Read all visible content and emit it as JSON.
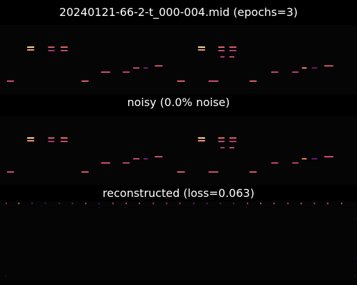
{
  "figure": {
    "title": "20240121-66-2-t_000-004.mid (epochs=3)"
  },
  "chart_data": [
    {
      "type": "heatmap",
      "panel": "original",
      "title": "",
      "background": "#050505",
      "xlim": [
        0,
        512
      ],
      "ylim": [
        0,
        100
      ],
      "colormap": "magma",
      "notes": [
        {
          "t": 10,
          "dur": 10,
          "p": 81,
          "v": 0.58
        },
        {
          "t": 39,
          "dur": 10,
          "p": 32,
          "v": 0.92
        },
        {
          "t": 39,
          "dur": 10,
          "p": 36,
          "v": 0.78
        },
        {
          "t": 69,
          "dur": 9,
          "p": 32,
          "v": 0.62
        },
        {
          "t": 69,
          "dur": 9,
          "p": 37,
          "v": 0.48
        },
        {
          "t": 87,
          "dur": 10,
          "p": 32,
          "v": 0.66
        },
        {
          "t": 87,
          "dur": 10,
          "p": 37,
          "v": 0.55
        },
        {
          "t": 117,
          "dur": 10,
          "p": 81,
          "v": 0.62
        },
        {
          "t": 145,
          "dur": 13,
          "p": 68,
          "v": 0.58
        },
        {
          "t": 176,
          "dur": 10,
          "p": 68,
          "v": 0.52
        },
        {
          "t": 191,
          "dur": 9,
          "p": 62,
          "v": 0.55
        },
        {
          "t": 206,
          "dur": 6,
          "p": 62,
          "v": 0.35
        },
        {
          "t": 222,
          "dur": 11,
          "p": 59,
          "v": 0.58
        },
        {
          "t": 254,
          "dur": 11,
          "p": 81,
          "v": 0.62
        },
        {
          "t": 284,
          "dur": 10,
          "p": 32,
          "v": 0.92
        },
        {
          "t": 284,
          "dur": 10,
          "p": 36,
          "v": 0.78
        },
        {
          "t": 299,
          "dur": 14,
          "p": 81,
          "v": 0.58
        },
        {
          "t": 313,
          "dur": 9,
          "p": 32,
          "v": 0.66
        },
        {
          "t": 313,
          "dur": 9,
          "p": 37,
          "v": 0.55
        },
        {
          "t": 316,
          "dur": 6,
          "p": 46,
          "v": 0.5
        },
        {
          "t": 329,
          "dur": 10,
          "p": 32,
          "v": 0.62
        },
        {
          "t": 329,
          "dur": 10,
          "p": 37,
          "v": 0.5
        },
        {
          "t": 329,
          "dur": 7,
          "p": 46,
          "v": 0.55
        },
        {
          "t": 358,
          "dur": 10,
          "p": 81,
          "v": 0.62
        },
        {
          "t": 389,
          "dur": 10,
          "p": 68,
          "v": 0.55
        },
        {
          "t": 419,
          "dur": 9,
          "p": 68,
          "v": 0.52
        },
        {
          "t": 433,
          "dur": 7,
          "p": 62,
          "v": 0.7
        },
        {
          "t": 447,
          "dur": 8,
          "p": 62,
          "v": 0.3
        },
        {
          "t": 465,
          "dur": 13,
          "p": 59,
          "v": 0.58
        }
      ]
    },
    {
      "type": "heatmap",
      "panel": "noisy",
      "title": "noisy (0.0% noise)",
      "background": "#050505",
      "xlim": [
        0,
        512
      ],
      "ylim": [
        0,
        100
      ],
      "colormap": "magma",
      "notes": [
        {
          "t": 10,
          "dur": 10,
          "p": 81,
          "v": 0.58
        },
        {
          "t": 39,
          "dur": 10,
          "p": 32,
          "v": 0.92
        },
        {
          "t": 39,
          "dur": 10,
          "p": 36,
          "v": 0.78
        },
        {
          "t": 69,
          "dur": 9,
          "p": 32,
          "v": 0.62
        },
        {
          "t": 69,
          "dur": 9,
          "p": 37,
          "v": 0.48
        },
        {
          "t": 87,
          "dur": 10,
          "p": 32,
          "v": 0.66
        },
        {
          "t": 87,
          "dur": 10,
          "p": 37,
          "v": 0.55
        },
        {
          "t": 117,
          "dur": 10,
          "p": 81,
          "v": 0.62
        },
        {
          "t": 145,
          "dur": 13,
          "p": 68,
          "v": 0.58
        },
        {
          "t": 176,
          "dur": 10,
          "p": 68,
          "v": 0.52
        },
        {
          "t": 191,
          "dur": 9,
          "p": 62,
          "v": 0.55
        },
        {
          "t": 206,
          "dur": 6,
          "p": 62,
          "v": 0.35
        },
        {
          "t": 222,
          "dur": 11,
          "p": 59,
          "v": 0.58
        },
        {
          "t": 254,
          "dur": 11,
          "p": 81,
          "v": 0.62
        },
        {
          "t": 284,
          "dur": 10,
          "p": 32,
          "v": 0.92
        },
        {
          "t": 284,
          "dur": 10,
          "p": 36,
          "v": 0.78
        },
        {
          "t": 299,
          "dur": 14,
          "p": 81,
          "v": 0.58
        },
        {
          "t": 313,
          "dur": 9,
          "p": 32,
          "v": 0.66
        },
        {
          "t": 313,
          "dur": 9,
          "p": 37,
          "v": 0.55
        },
        {
          "t": 316,
          "dur": 6,
          "p": 46,
          "v": 0.5
        },
        {
          "t": 329,
          "dur": 10,
          "p": 32,
          "v": 0.62
        },
        {
          "t": 329,
          "dur": 10,
          "p": 37,
          "v": 0.5
        },
        {
          "t": 329,
          "dur": 7,
          "p": 46,
          "v": 0.55
        },
        {
          "t": 358,
          "dur": 10,
          "p": 81,
          "v": 0.62
        },
        {
          "t": 389,
          "dur": 10,
          "p": 68,
          "v": 0.55
        },
        {
          "t": 419,
          "dur": 9,
          "p": 68,
          "v": 0.52
        },
        {
          "t": 433,
          "dur": 7,
          "p": 62,
          "v": 0.7
        },
        {
          "t": 447,
          "dur": 8,
          "p": 62,
          "v": 0.3
        },
        {
          "t": 465,
          "dur": 13,
          "p": 59,
          "v": 0.58
        }
      ]
    },
    {
      "type": "heatmap",
      "panel": "reconstructed",
      "title": "reconstructed (loss=0.063)",
      "background": "#050505",
      "xlim": [
        0,
        512
      ],
      "ylim": [
        0,
        100
      ],
      "colormap": "magma",
      "notes": [
        {
          "t": 8,
          "dur": 2,
          "p": 3,
          "v": 0.45
        },
        {
          "t": 26,
          "dur": 2,
          "p": 3,
          "v": 0.65
        },
        {
          "t": 45,
          "dur": 2,
          "p": 3,
          "v": 0.3
        },
        {
          "t": 64,
          "dur": 2,
          "p": 3,
          "v": 0.25
        },
        {
          "t": 84,
          "dur": 2,
          "p": 3,
          "v": 0.3
        },
        {
          "t": 103,
          "dur": 2,
          "p": 3,
          "v": 0.35
        },
        {
          "t": 122,
          "dur": 2,
          "p": 3,
          "v": 0.6
        },
        {
          "t": 141,
          "dur": 2,
          "p": 3,
          "v": 0.25
        },
        {
          "t": 161,
          "dur": 2,
          "p": 3,
          "v": 0.55
        },
        {
          "t": 180,
          "dur": 2,
          "p": 3,
          "v": 0.6
        },
        {
          "t": 199,
          "dur": 2,
          "p": 3,
          "v": 0.6
        },
        {
          "t": 219,
          "dur": 2,
          "p": 3,
          "v": 0.55
        },
        {
          "t": 238,
          "dur": 2,
          "p": 3,
          "v": 0.5
        },
        {
          "t": 257,
          "dur": 2,
          "p": 3,
          "v": 0.5
        },
        {
          "t": 277,
          "dur": 2,
          "p": 3,
          "v": 0.35
        },
        {
          "t": 296,
          "dur": 2,
          "p": 3,
          "v": 0.3
        },
        {
          "t": 315,
          "dur": 2,
          "p": 3,
          "v": 0.3
        },
        {
          "t": 334,
          "dur": 2,
          "p": 3,
          "v": 0.3
        },
        {
          "t": 354,
          "dur": 2,
          "p": 3,
          "v": 0.55
        },
        {
          "t": 373,
          "dur": 2,
          "p": 3,
          "v": 0.65
        },
        {
          "t": 392,
          "dur": 2,
          "p": 3,
          "v": 0.6
        },
        {
          "t": 412,
          "dur": 2,
          "p": 3,
          "v": 0.55
        },
        {
          "t": 431,
          "dur": 2,
          "p": 3,
          "v": 0.6
        },
        {
          "t": 450,
          "dur": 2,
          "p": 3,
          "v": 0.55
        },
        {
          "t": 469,
          "dur": 2,
          "p": 3,
          "v": 0.6
        },
        {
          "t": 489,
          "dur": 2,
          "p": 3,
          "v": 0.6
        },
        {
          "t": 142,
          "dur": 1,
          "p": 8,
          "v": 0.2
        },
        {
          "t": 179,
          "dur": 1,
          "p": 8,
          "v": 0.15
        },
        {
          "t": 353,
          "dur": 1,
          "p": 8,
          "v": 0.2
        },
        {
          "t": 510,
          "dur": 1,
          "p": 22,
          "v": 0.15
        },
        {
          "t": 510,
          "dur": 1,
          "p": 72,
          "v": 0.15
        },
        {
          "t": 8,
          "dur": 1,
          "p": 94,
          "v": 0.15
        },
        {
          "t": 509,
          "dur": 1,
          "p": 94,
          "v": 0.15
        }
      ]
    }
  ]
}
